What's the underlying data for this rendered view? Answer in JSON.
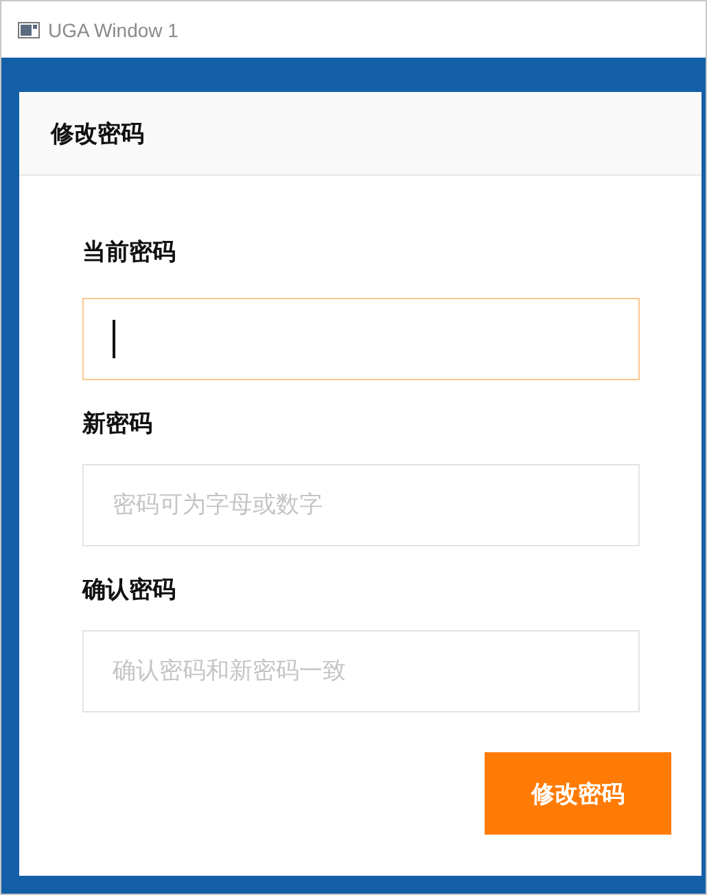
{
  "window": {
    "title": "UGA Window 1"
  },
  "card": {
    "title": "修改密码"
  },
  "fields": [
    {
      "label": "当前密码",
      "focused": true
    },
    {
      "label": "新密码",
      "placeholder": "密码可为字母或数字",
      "focused": false
    },
    {
      "label": "确认密码",
      "placeholder": "确认密码和新密码一致",
      "focused": false
    }
  ],
  "submit_button": {
    "label": "修改密码"
  }
}
